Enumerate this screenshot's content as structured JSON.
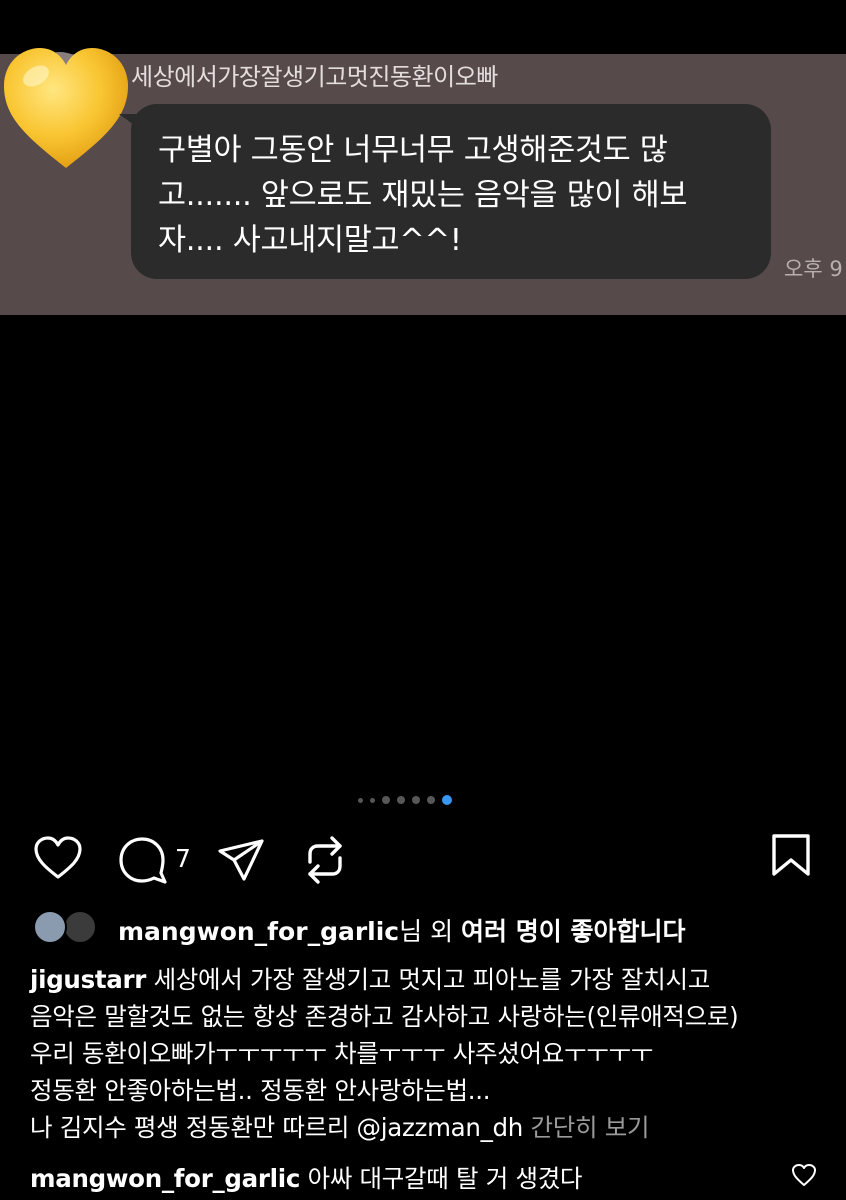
{
  "chat": {
    "sender_name": "세상에서가장잘생기고멋진동환이오빠",
    "message_lines": [
      "구별아 그동안 너무너무 고생해준것도 많",
      "고....... 앞으로도 재밌는 음악을 많이 해보",
      "자.... 사고내지말고^^!"
    ],
    "time": "오후 9",
    "sticker": "yellow-heart-icon",
    "band_color": "#574a4b",
    "bubble_color": "#2b2b2b"
  },
  "carousel": {
    "total": 7,
    "active_index": 6,
    "active_color": "#3897f0"
  },
  "actions": {
    "comment_count": "7",
    "icons": [
      "heart-icon",
      "comment-icon",
      "share-icon",
      "remix-icon",
      "bookmark-icon"
    ]
  },
  "likes": {
    "username": "mangwon_for_garlic",
    "suffix": "님 외 ",
    "others": "여러 명이 좋아합니다"
  },
  "caption": {
    "username": "jigustarr",
    "first_line_text": " 세상에서 가장 잘생기고 멋지고 피아노를 가장 잘치시고",
    "lines": [
      "음악은 말할것도 없는 항상 존경하고 감사하고 사랑하는(인류애적으로)",
      "우리 동환이오빠가ㅜㅜㅜㅜㅜ 차를ㅜㅜㅜ 사주셨어요ㅜㅜㅜㅜ",
      "정동환 안좋아하는법.. 정동환 안사랑하는법...",
      "나 김지수 평생 정동환만 따르리 @jazzman_dh "
    ],
    "more_label": "간단히 보기"
  },
  "comment": {
    "username": "mangwon_for_garlic",
    "text": " 아싸 대구갈때 탈 거 생겼다",
    "like_icon": "heart-icon"
  }
}
